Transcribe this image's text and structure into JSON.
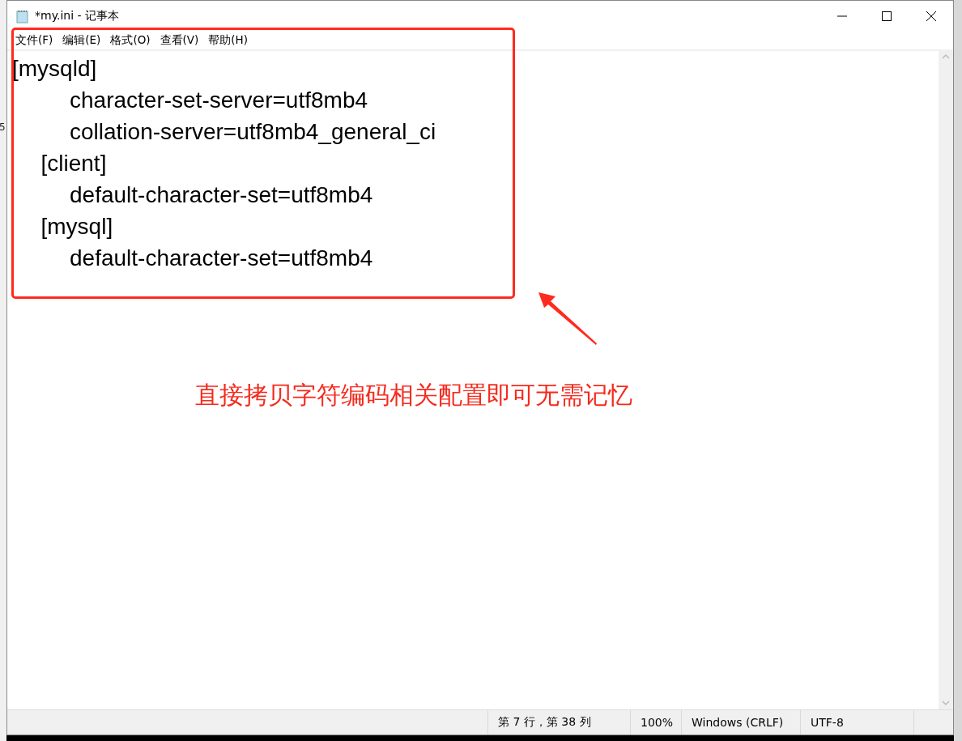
{
  "background": {
    "side_text": "5"
  },
  "window": {
    "title": "*my.ini - 记事本"
  },
  "menu": [
    "文件(F)",
    "编辑(E)",
    "格式(O)",
    "查看(V)",
    "帮助(H)"
  ],
  "editor": {
    "lines": [
      "[mysqld]",
      "\t\tcharacter-set-server=utf8mb4",
      "\t\tcollation-server=utf8mb4_general_ci",
      "\t[client]",
      "\t\tdefault-character-set=utf8mb4",
      "\t[mysql]",
      "\t\tdefault-character-set=utf8mb4"
    ]
  },
  "status_bar": [
    "第 7 行，第 38 列",
    "100%",
    "Windows (CRLF)",
    "UTF-8"
  ],
  "annotation": {
    "text": "直接拷贝字符编码相关配置即可无需记忆"
  }
}
